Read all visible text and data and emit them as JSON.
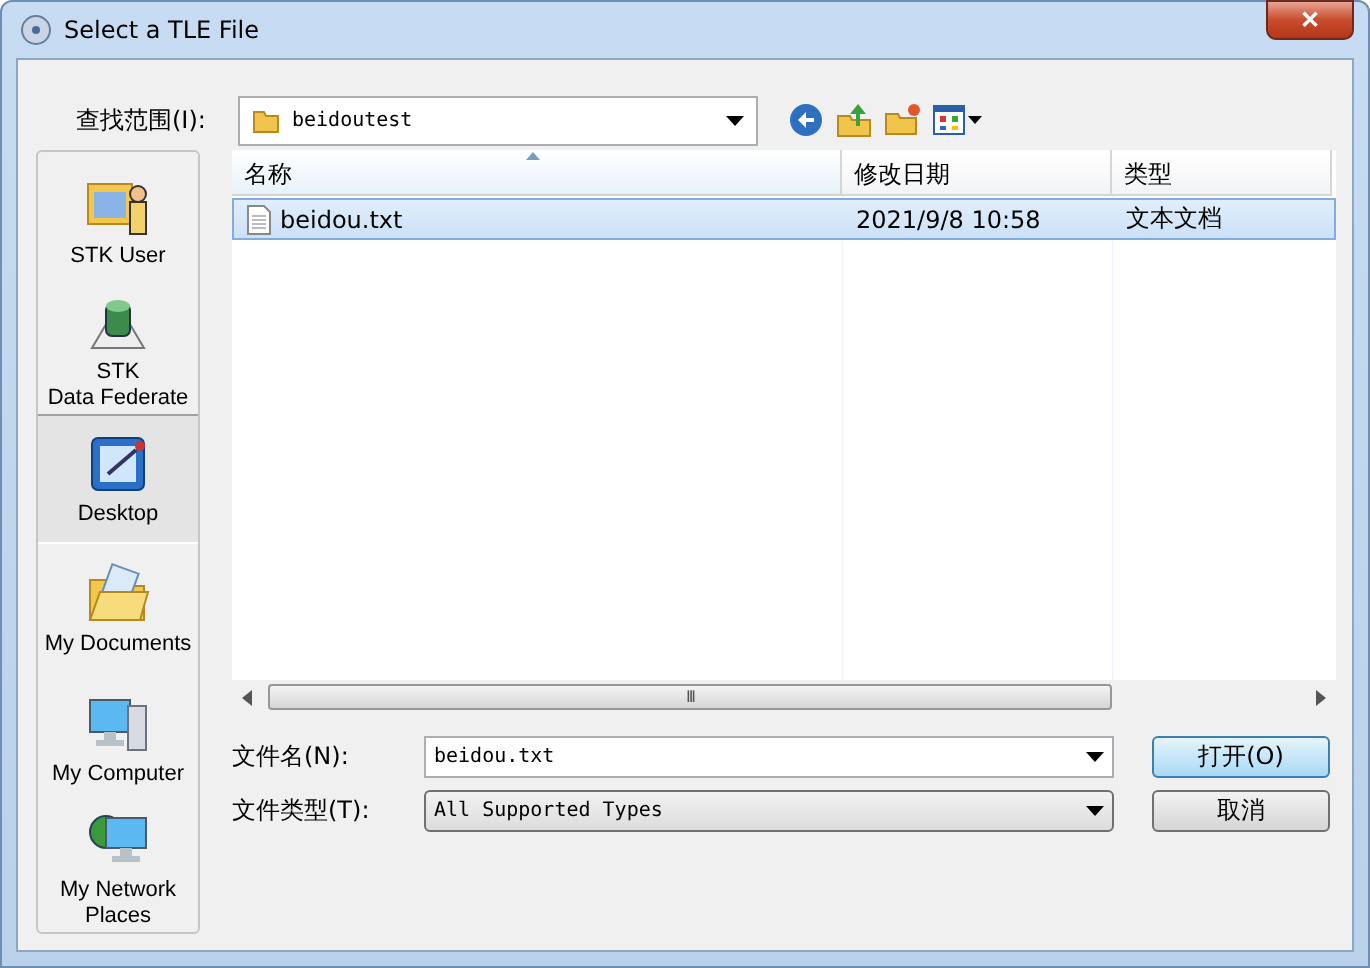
{
  "window": {
    "title": "Select a TLE File",
    "close_label": "✕"
  },
  "look_in": {
    "label": "查找范围(I):",
    "value": "beidoutest"
  },
  "places": [
    {
      "label": "STK User",
      "kind": "user",
      "selected": false
    },
    {
      "label": "STK\nData Federate",
      "kind": "database",
      "selected": false
    },
    {
      "label": "Desktop",
      "kind": "desktop",
      "selected": true
    },
    {
      "label": "My Documents",
      "kind": "documents",
      "selected": false
    },
    {
      "label": "My Computer",
      "kind": "computer",
      "selected": false
    },
    {
      "label": "My Network\nPlaces",
      "kind": "network",
      "selected": false
    }
  ],
  "file_list": {
    "columns": [
      {
        "label": "名称",
        "sorted": true
      },
      {
        "label": "修改日期",
        "sorted": false
      },
      {
        "label": "类型",
        "sorted": false
      }
    ],
    "rows": [
      {
        "name": "beidou.txt",
        "modified": "2021/9/8 10:58",
        "type": "文本文档",
        "selected": true
      }
    ],
    "scroll_grip": "III"
  },
  "file_name": {
    "label": "文件名(N):",
    "value": "beidou.txt"
  },
  "file_type": {
    "label": "文件类型(T):",
    "value": "All Supported Types"
  },
  "buttons": [
    {
      "label": "打开(O)",
      "default": true
    },
    {
      "label": "取消",
      "default": false
    }
  ]
}
